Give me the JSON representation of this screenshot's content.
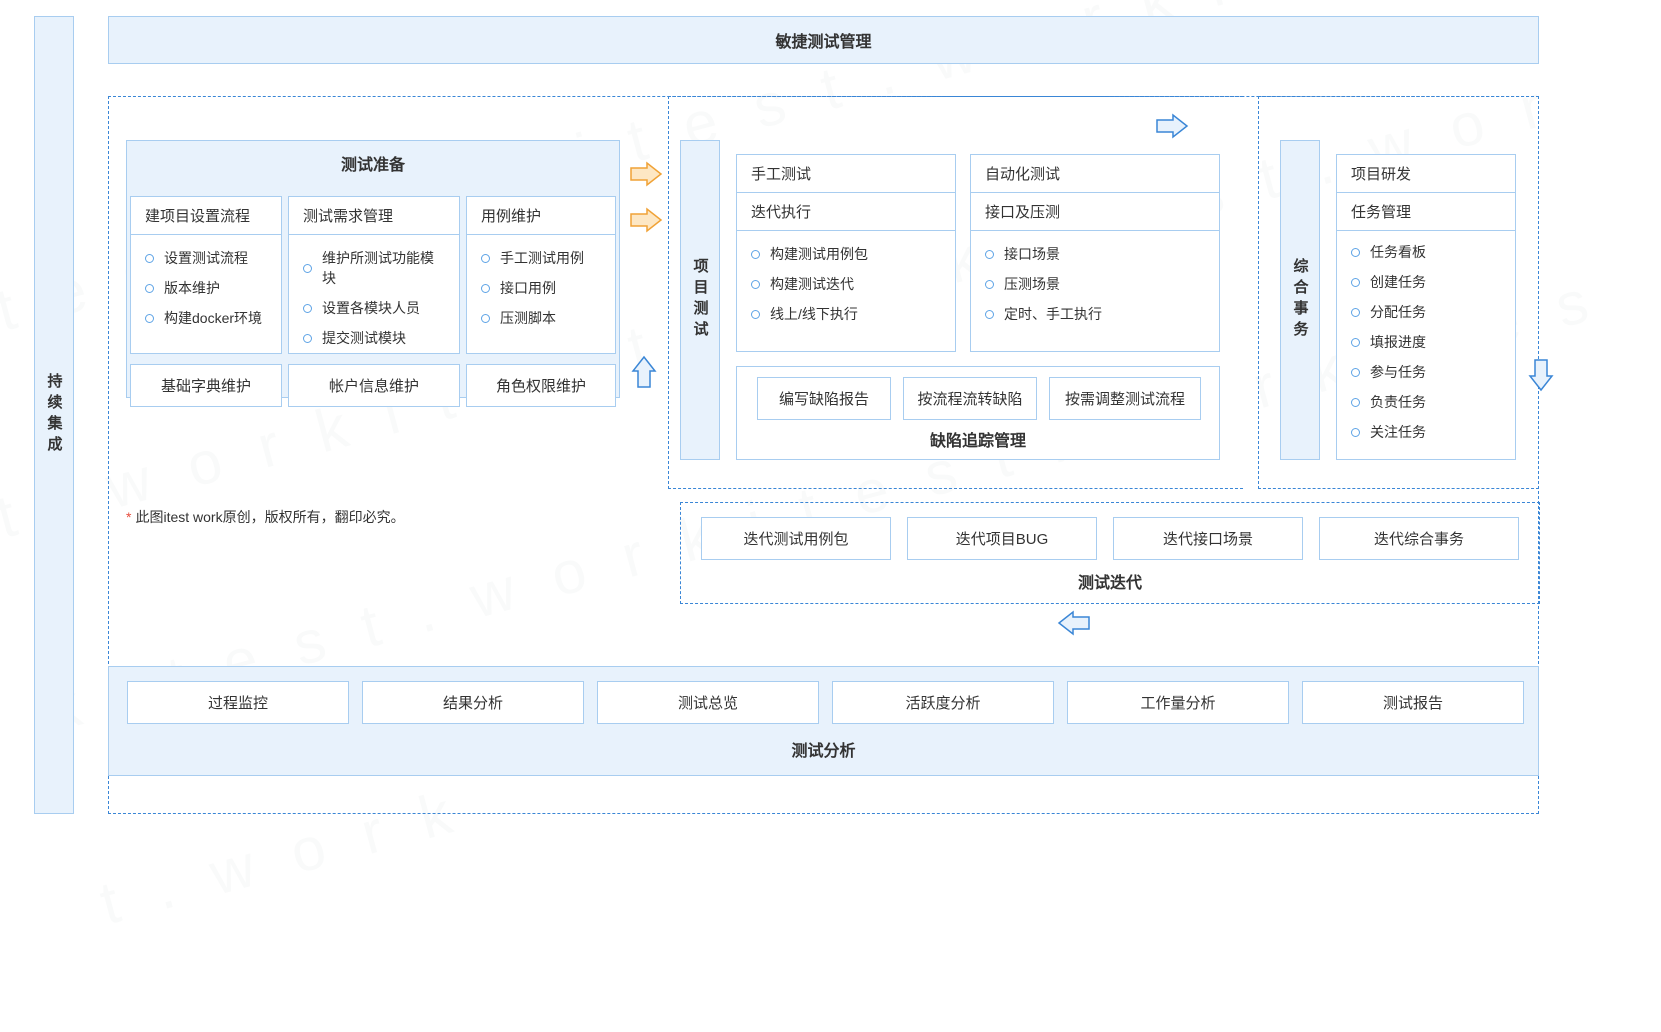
{
  "title": "敏捷测试管理",
  "ci_label": "持续集成",
  "test_prep": {
    "title": "测试准备",
    "col1": {
      "head": "建项目设置流程",
      "items": [
        "设置测试流程",
        "版本维护",
        "构建docker环境"
      ]
    },
    "col2": {
      "head": "测试需求管理",
      "items": [
        "维护所测试功能模块",
        "设置各模块人员",
        "提交测试模块"
      ]
    },
    "col3": {
      "head": "用例维护",
      "items": [
        "手工测试用例",
        "接口用例",
        "压测脚本"
      ]
    },
    "bottom": [
      "基础字典维护",
      "帐户信息维护",
      "角色权限维护"
    ]
  },
  "project_test_label": "项目测试",
  "manual": {
    "head": "手工测试",
    "sub": "迭代执行",
    "items": [
      "构建测试用例包",
      "构建测试迭代",
      "线上/线下执行"
    ]
  },
  "auto": {
    "head": "自动化测试",
    "sub": "接口及压测",
    "items": [
      "接口场景",
      "压测场景",
      "定时、手工执行"
    ]
  },
  "defect": {
    "buttons": [
      "编写缺陷报告",
      "按流程流转缺陷",
      "按需调整测试流程"
    ],
    "label": "缺陷追踪管理"
  },
  "affairs_label": "综合事务",
  "rnd": {
    "head": "项目研发",
    "sub": "任务管理",
    "items": [
      "任务看板",
      "创建任务",
      "分配任务",
      "填报进度",
      "参与任务",
      "负责任务",
      "关注任务"
    ]
  },
  "footnote": "此图itest work原创，版权所有，翻印必究。",
  "iteration": {
    "buttons": [
      "迭代测试用例包",
      "迭代项目BUG",
      "迭代接口场景",
      "迭代综合事务"
    ],
    "label": "测试迭代"
  },
  "analysis": {
    "buttons": [
      "过程监控",
      "结果分析",
      "测试总览",
      "活跃度分析",
      "工作量分析",
      "测试报告"
    ],
    "label": "测试分析"
  }
}
